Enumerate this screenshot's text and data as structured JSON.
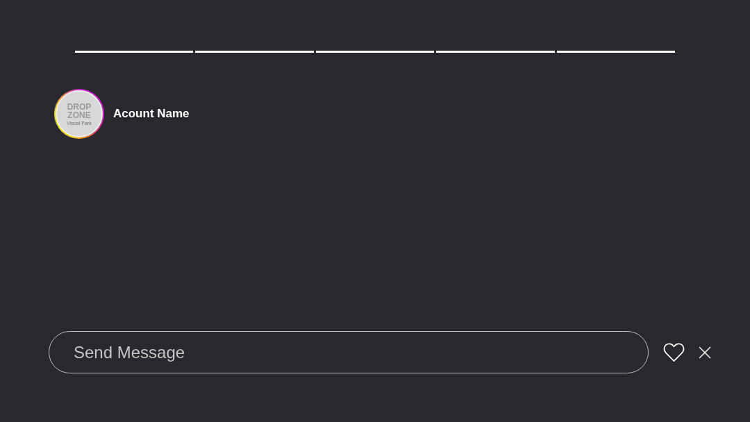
{
  "progress": [
    {
      "level": 1
    },
    {
      "level": 1
    },
    {
      "level": 1
    },
    {
      "level": 1
    },
    {
      "level": 1
    }
  ],
  "account": {
    "avatar": {
      "logo": "DROP ZONE",
      "tagline": "Visual Park"
    },
    "name": "Acount Name"
  },
  "composer": {
    "placeholder": "Send Message"
  }
}
